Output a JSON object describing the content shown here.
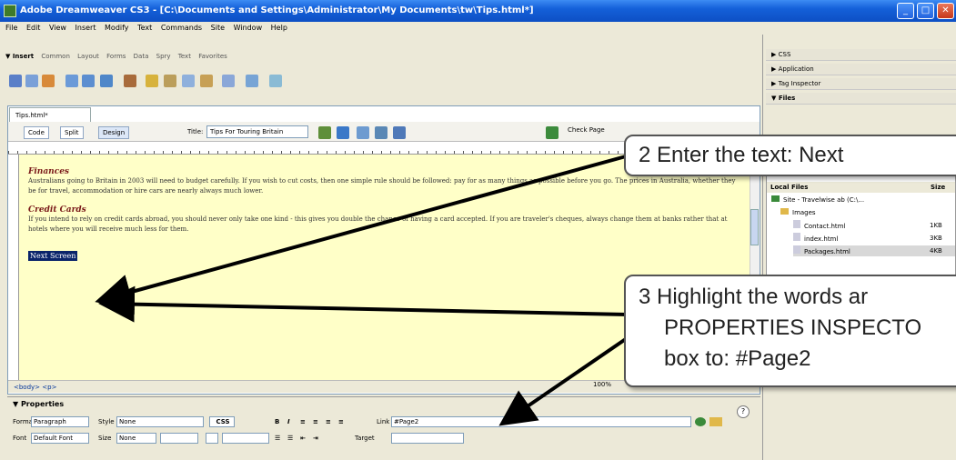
{
  "window": {
    "title": "Adobe Dreamweaver CS3 - [C:\\Documents and Settings\\Administrator\\My Documents\\tw\\Tips.html*]"
  },
  "menu": [
    "File",
    "Edit",
    "View",
    "Insert",
    "Modify",
    "Text",
    "Commands",
    "Site",
    "Window",
    "Help"
  ],
  "insert_bar": {
    "title": "▼ Insert",
    "tabs": [
      "Common",
      "Layout",
      "Forms",
      "Data",
      "Spry",
      "Text",
      "Favorites"
    ]
  },
  "document": {
    "tab": "Tips.html*",
    "buttons": {
      "code": "Code",
      "split": "Split",
      "design": "Design",
      "check_page": "Check Page"
    },
    "title_label": "Title:",
    "title_value": "Tips For Touring Britain",
    "finances_heading": "Finances",
    "finances_text": "Australians going to Britain in 2003 will need to budget carefully. If you wish to cut costs, then one simple rule should be followed: pay for as many things as possible before you go. The prices in Australia, whether they be for travel, accommodation or hire cars are nearly always much lower.",
    "credit_heading": "Credit Cards",
    "credit_text": "If you intend to rely on credit cards abroad, you should never only take one kind - this gives you double the chance of having a card accepted. If you are traveler's cheques, always change them at banks rather that at hotels where you will receive much less for them.",
    "selected_text": "Next Screen",
    "status_tags": "<body> <p>",
    "zoom": "100%"
  },
  "properties": {
    "title": "▼ Properties",
    "format_label": "Format",
    "format_value": "Paragraph",
    "style_label": "Style",
    "style_value": "None",
    "css_label": "CSS",
    "link_label": "Link",
    "link_value": "#Page2",
    "font_label": "Font",
    "font_value": "Default Font",
    "size_label": "Size",
    "size_value": "None",
    "target_label": "Target"
  },
  "panels": {
    "css": "▶ CSS",
    "application": "▶ Application",
    "tag_inspector": "▶ Tag Inspector",
    "files": "▼ Files",
    "local_files": "Local Files",
    "size_col": "Size",
    "items": [
      "Site - Travelwise ab (C:\\...",
      "Images",
      "Contact.html",
      "index.html",
      "Packages.html"
    ],
    "sizes": [
      "",
      "",
      "1KB",
      "3KB",
      "4KB"
    ]
  },
  "callouts": {
    "step2": "2  Enter the text:    Next",
    "step3_line1": "3  Highlight the words ar",
    "step3_line2": "PROPERTIES INSPECTO",
    "step3_line3": "box to:   #Page2"
  }
}
